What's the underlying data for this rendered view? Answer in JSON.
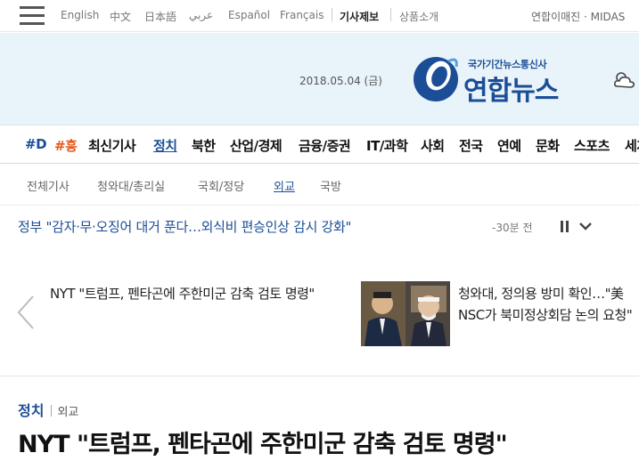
{
  "topbar": {
    "languages": [
      "English",
      "中文",
      "日本語",
      "عربي",
      "Español",
      "Français"
    ],
    "highlight_links": [
      "기사제보",
      "상품소개"
    ],
    "right_links": "연합이매진 · MIDAS"
  },
  "header": {
    "date": "2018.05.04 (금)",
    "logo_tagline": "국가기간뉴스통신사",
    "logo_name": "연합뉴스"
  },
  "nav": {
    "items": [
      "#D",
      "#흥",
      "최신기사",
      "정치",
      "북한",
      "산업/경제",
      "금융/증권",
      "IT/과학",
      "사회",
      "전국",
      "연예",
      "문화",
      "스포츠",
      "세계"
    ],
    "active": "정치"
  },
  "subnav": {
    "items": [
      "전체기사",
      "청와대/총리실",
      "국회/정당",
      "외교",
      "국방"
    ],
    "active": "외교"
  },
  "ticker": {
    "headline": "정부 \"감자·무·오징어 대거 푼다…외식비 편승인상 감시 강화\"",
    "time": "-30분 전"
  },
  "related": {
    "left_title": "NYT \"트럼프, 펜타곤에 주한미군 감축 검토 명령\"",
    "right_title": "청와대, 정의용 방미 확인…\"美 NSC가 북미정상회담 논의 요청\""
  },
  "article": {
    "section": "정치",
    "subsection": "외교",
    "headline": "NYT \"트럼프, 펜타곤에 주한미군 감축 검토 명령\""
  },
  "icons": {
    "menu": "hamburger-menu-icon",
    "weather": "cloud-icon",
    "pause": "pause-icon",
    "expand": "chevron-down-icon",
    "prev": "chevron-left-icon"
  },
  "colors": {
    "brand_blue": "#1b4e97",
    "header_bg": "#e9f3fa",
    "accent_orange": "#e25b1a"
  }
}
